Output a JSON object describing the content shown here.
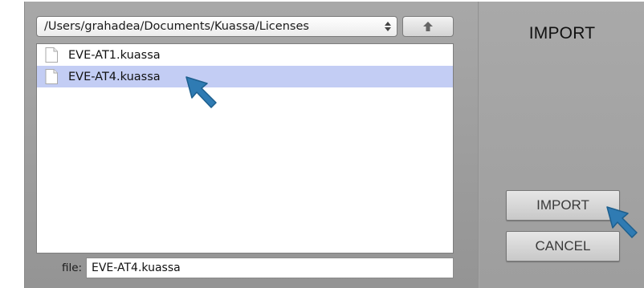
{
  "path_select": {
    "value": "/Users/grahadea/Documents/Kuassa/Licenses",
    "icon": "up-down-arrows-icon"
  },
  "up_button": {
    "icon": "up-arrow-icon"
  },
  "file_list": {
    "items": [
      {
        "name": "EVE-AT1.kuassa",
        "selected": false,
        "icon": "document-icon"
      },
      {
        "name": "EVE-AT4.kuassa",
        "selected": true,
        "icon": "document-icon"
      }
    ]
  },
  "file_field": {
    "label": "file:",
    "value": "EVE-AT4.kuassa"
  },
  "panel": {
    "title": "IMPORT",
    "import_label": "IMPORT",
    "cancel_label": "CANCEL"
  },
  "colors": {
    "selection": "#c3cdf4",
    "pointer": "#2f7bb3"
  }
}
